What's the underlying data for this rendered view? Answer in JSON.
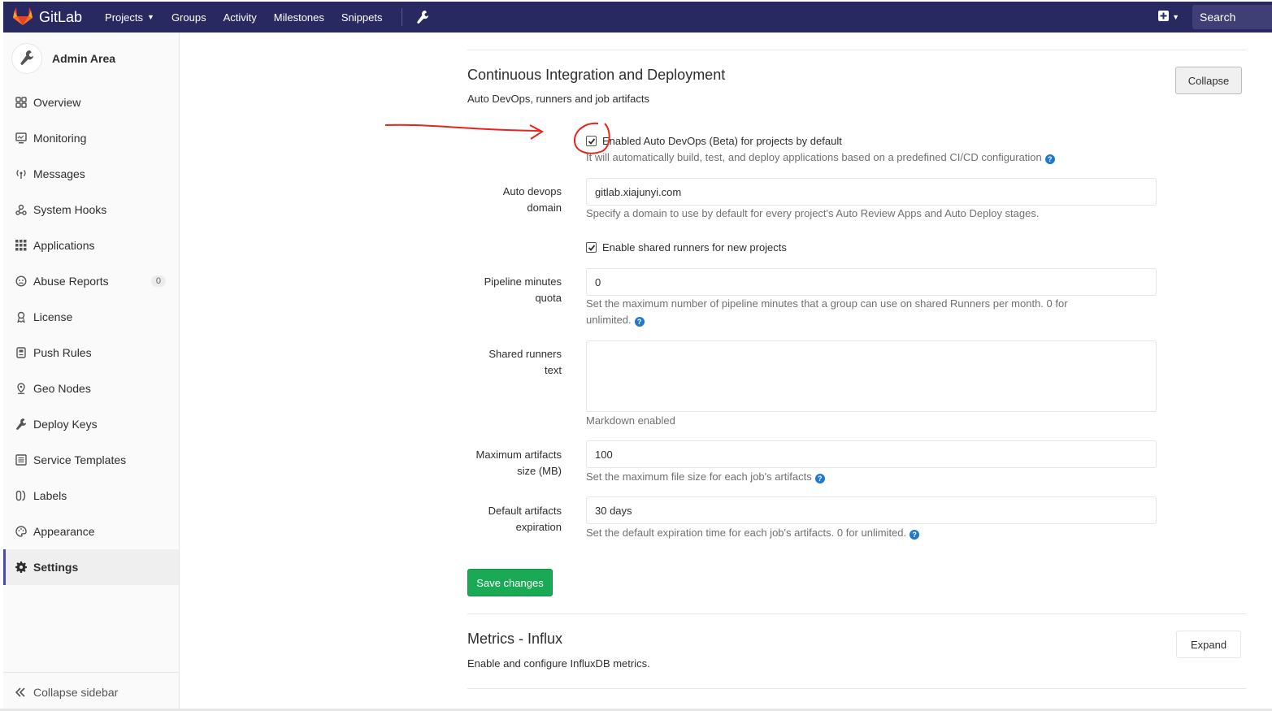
{
  "navbar": {
    "brand": "GitLab",
    "links": [
      {
        "label": "Projects",
        "has_caret": true
      },
      {
        "label": "Groups"
      },
      {
        "label": "Activity"
      },
      {
        "label": "Milestones"
      },
      {
        "label": "Snippets"
      }
    ],
    "search_label": "Search",
    "colors": {
      "background": "#292961",
      "search": "#3f3f75"
    }
  },
  "sidebar": {
    "title": "Admin Area",
    "items": [
      {
        "label": "Overview",
        "icon": "overview-icon"
      },
      {
        "label": "Monitoring",
        "icon": "monitoring-icon"
      },
      {
        "label": "Messages",
        "icon": "messages-icon"
      },
      {
        "label": "System Hooks",
        "icon": "hook-icon"
      },
      {
        "label": "Applications",
        "icon": "applications-icon"
      },
      {
        "label": "Abuse Reports",
        "icon": "abuse-icon",
        "badge": "0"
      },
      {
        "label": "License",
        "icon": "license-icon"
      },
      {
        "label": "Push Rules",
        "icon": "push-rules-icon"
      },
      {
        "label": "Geo Nodes",
        "icon": "geo-icon"
      },
      {
        "label": "Deploy Keys",
        "icon": "key-icon"
      },
      {
        "label": "Service Templates",
        "icon": "templates-icon"
      },
      {
        "label": "Labels",
        "icon": "labels-icon"
      },
      {
        "label": "Appearance",
        "icon": "appearance-icon"
      },
      {
        "label": "Settings",
        "icon": "settings-icon",
        "active": true
      }
    ],
    "collapse_label": "Collapse sidebar"
  },
  "ci_section": {
    "title": "Continuous Integration and Deployment",
    "description": "Auto DevOps, runners and job artifacts",
    "collapse_label": "Collapse",
    "auto_devops": {
      "label": "Enabled Auto DevOps (Beta) for projects by default",
      "checked": true,
      "help": "It will automatically build, test, and deploy applications based on a predefined CI/CD configuration"
    },
    "domain": {
      "label_line1": "Auto devops",
      "label_line2": "domain",
      "value": "gitlab.xiajunyi.com",
      "help": "Specify a domain to use by default for every project's Auto Review Apps and Auto Deploy stages."
    },
    "shared_runners": {
      "label": "Enable shared runners for new projects",
      "checked": true
    },
    "pipeline_quota": {
      "label_line1": "Pipeline minutes",
      "label_line2": "quota",
      "value": "0",
      "help_line1": "Set the maximum number of pipeline minutes that a group can use on shared Runners per month. 0 for",
      "help_line2": "unlimited."
    },
    "runners_text": {
      "label_line1": "Shared runners",
      "label_line2": "text",
      "value": "",
      "help": "Markdown enabled"
    },
    "max_artifacts": {
      "label_line1": "Maximum artifacts",
      "label_line2": "size (MB)",
      "value": "100",
      "help": "Set the maximum file size for each job's artifacts"
    },
    "expiration": {
      "label_line1": "Default artifacts",
      "label_line2": "expiration",
      "value": "30 days",
      "help": "Set the default expiration time for each job's artifacts. 0 for unlimited."
    },
    "save_label": "Save changes",
    "save_color": "#1aaa55"
  },
  "metrics_section": {
    "title": "Metrics - Influx",
    "description": "Enable and configure InfluxDB metrics.",
    "expand_label": "Expand"
  },
  "annotation_color": "#e8231d"
}
